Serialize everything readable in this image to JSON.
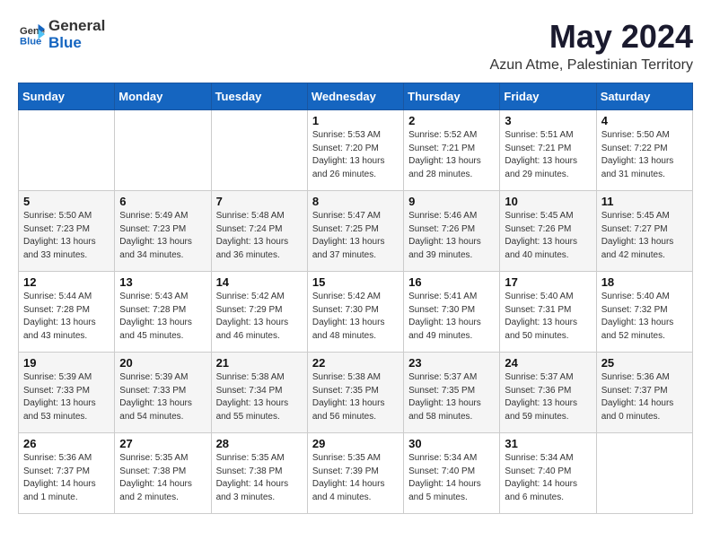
{
  "header": {
    "logo_general": "General",
    "logo_blue": "Blue",
    "month": "May 2024",
    "location": "Azun Atme, Palestinian Territory"
  },
  "weekdays": [
    "Sunday",
    "Monday",
    "Tuesday",
    "Wednesday",
    "Thursday",
    "Friday",
    "Saturday"
  ],
  "weeks": [
    [
      {
        "day": "",
        "sunrise": "",
        "sunset": "",
        "daylight": ""
      },
      {
        "day": "",
        "sunrise": "",
        "sunset": "",
        "daylight": ""
      },
      {
        "day": "",
        "sunrise": "",
        "sunset": "",
        "daylight": ""
      },
      {
        "day": "1",
        "sunrise": "Sunrise: 5:53 AM",
        "sunset": "Sunset: 7:20 PM",
        "daylight": "Daylight: 13 hours and 26 minutes."
      },
      {
        "day": "2",
        "sunrise": "Sunrise: 5:52 AM",
        "sunset": "Sunset: 7:21 PM",
        "daylight": "Daylight: 13 hours and 28 minutes."
      },
      {
        "day": "3",
        "sunrise": "Sunrise: 5:51 AM",
        "sunset": "Sunset: 7:21 PM",
        "daylight": "Daylight: 13 hours and 29 minutes."
      },
      {
        "day": "4",
        "sunrise": "Sunrise: 5:50 AM",
        "sunset": "Sunset: 7:22 PM",
        "daylight": "Daylight: 13 hours and 31 minutes."
      }
    ],
    [
      {
        "day": "5",
        "sunrise": "Sunrise: 5:50 AM",
        "sunset": "Sunset: 7:23 PM",
        "daylight": "Daylight: 13 hours and 33 minutes."
      },
      {
        "day": "6",
        "sunrise": "Sunrise: 5:49 AM",
        "sunset": "Sunset: 7:23 PM",
        "daylight": "Daylight: 13 hours and 34 minutes."
      },
      {
        "day": "7",
        "sunrise": "Sunrise: 5:48 AM",
        "sunset": "Sunset: 7:24 PM",
        "daylight": "Daylight: 13 hours and 36 minutes."
      },
      {
        "day": "8",
        "sunrise": "Sunrise: 5:47 AM",
        "sunset": "Sunset: 7:25 PM",
        "daylight": "Daylight: 13 hours and 37 minutes."
      },
      {
        "day": "9",
        "sunrise": "Sunrise: 5:46 AM",
        "sunset": "Sunset: 7:26 PM",
        "daylight": "Daylight: 13 hours and 39 minutes."
      },
      {
        "day": "10",
        "sunrise": "Sunrise: 5:45 AM",
        "sunset": "Sunset: 7:26 PM",
        "daylight": "Daylight: 13 hours and 40 minutes."
      },
      {
        "day": "11",
        "sunrise": "Sunrise: 5:45 AM",
        "sunset": "Sunset: 7:27 PM",
        "daylight": "Daylight: 13 hours and 42 minutes."
      }
    ],
    [
      {
        "day": "12",
        "sunrise": "Sunrise: 5:44 AM",
        "sunset": "Sunset: 7:28 PM",
        "daylight": "Daylight: 13 hours and 43 minutes."
      },
      {
        "day": "13",
        "sunrise": "Sunrise: 5:43 AM",
        "sunset": "Sunset: 7:28 PM",
        "daylight": "Daylight: 13 hours and 45 minutes."
      },
      {
        "day": "14",
        "sunrise": "Sunrise: 5:42 AM",
        "sunset": "Sunset: 7:29 PM",
        "daylight": "Daylight: 13 hours and 46 minutes."
      },
      {
        "day": "15",
        "sunrise": "Sunrise: 5:42 AM",
        "sunset": "Sunset: 7:30 PM",
        "daylight": "Daylight: 13 hours and 48 minutes."
      },
      {
        "day": "16",
        "sunrise": "Sunrise: 5:41 AM",
        "sunset": "Sunset: 7:30 PM",
        "daylight": "Daylight: 13 hours and 49 minutes."
      },
      {
        "day": "17",
        "sunrise": "Sunrise: 5:40 AM",
        "sunset": "Sunset: 7:31 PM",
        "daylight": "Daylight: 13 hours and 50 minutes."
      },
      {
        "day": "18",
        "sunrise": "Sunrise: 5:40 AM",
        "sunset": "Sunset: 7:32 PM",
        "daylight": "Daylight: 13 hours and 52 minutes."
      }
    ],
    [
      {
        "day": "19",
        "sunrise": "Sunrise: 5:39 AM",
        "sunset": "Sunset: 7:33 PM",
        "daylight": "Daylight: 13 hours and 53 minutes."
      },
      {
        "day": "20",
        "sunrise": "Sunrise: 5:39 AM",
        "sunset": "Sunset: 7:33 PM",
        "daylight": "Daylight: 13 hours and 54 minutes."
      },
      {
        "day": "21",
        "sunrise": "Sunrise: 5:38 AM",
        "sunset": "Sunset: 7:34 PM",
        "daylight": "Daylight: 13 hours and 55 minutes."
      },
      {
        "day": "22",
        "sunrise": "Sunrise: 5:38 AM",
        "sunset": "Sunset: 7:35 PM",
        "daylight": "Daylight: 13 hours and 56 minutes."
      },
      {
        "day": "23",
        "sunrise": "Sunrise: 5:37 AM",
        "sunset": "Sunset: 7:35 PM",
        "daylight": "Daylight: 13 hours and 58 minutes."
      },
      {
        "day": "24",
        "sunrise": "Sunrise: 5:37 AM",
        "sunset": "Sunset: 7:36 PM",
        "daylight": "Daylight: 13 hours and 59 minutes."
      },
      {
        "day": "25",
        "sunrise": "Sunrise: 5:36 AM",
        "sunset": "Sunset: 7:37 PM",
        "daylight": "Daylight: 14 hours and 0 minutes."
      }
    ],
    [
      {
        "day": "26",
        "sunrise": "Sunrise: 5:36 AM",
        "sunset": "Sunset: 7:37 PM",
        "daylight": "Daylight: 14 hours and 1 minute."
      },
      {
        "day": "27",
        "sunrise": "Sunrise: 5:35 AM",
        "sunset": "Sunset: 7:38 PM",
        "daylight": "Daylight: 14 hours and 2 minutes."
      },
      {
        "day": "28",
        "sunrise": "Sunrise: 5:35 AM",
        "sunset": "Sunset: 7:38 PM",
        "daylight": "Daylight: 14 hours and 3 minutes."
      },
      {
        "day": "29",
        "sunrise": "Sunrise: 5:35 AM",
        "sunset": "Sunset: 7:39 PM",
        "daylight": "Daylight: 14 hours and 4 minutes."
      },
      {
        "day": "30",
        "sunrise": "Sunrise: 5:34 AM",
        "sunset": "Sunset: 7:40 PM",
        "daylight": "Daylight: 14 hours and 5 minutes."
      },
      {
        "day": "31",
        "sunrise": "Sunrise: 5:34 AM",
        "sunset": "Sunset: 7:40 PM",
        "daylight": "Daylight: 14 hours and 6 minutes."
      },
      {
        "day": "",
        "sunrise": "",
        "sunset": "",
        "daylight": ""
      }
    ]
  ]
}
